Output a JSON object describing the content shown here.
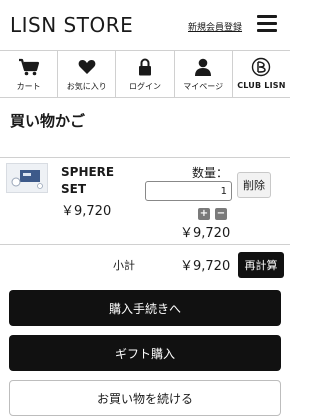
{
  "header": {
    "logo": "LISN STORE",
    "register_link": "新規会員登録"
  },
  "navbar": {
    "items": [
      {
        "label": "カート",
        "icon": "cart-icon"
      },
      {
        "label": "お気に入り",
        "icon": "heart-icon"
      },
      {
        "label": "ログイン",
        "icon": "lock-icon"
      },
      {
        "label": "マイページ",
        "icon": "user-icon"
      },
      {
        "label": "CLUB LISN",
        "icon": "club-lisn-icon"
      }
    ]
  },
  "page": {
    "title": "買い物かご"
  },
  "cart": {
    "items": [
      {
        "name_line1": "SPHERE",
        "name_line2": "SET",
        "price": "￥9,720",
        "quantity_label": "数量：",
        "quantity": "1",
        "delete_label": "削除",
        "line_total": "￥9,720"
      }
    ],
    "subtotal_label": "小計",
    "subtotal_value": "￥9,720",
    "recalc_label": "再計算"
  },
  "actions": {
    "checkout_label": "購入手続きへ",
    "gift_label": "ギフト購入",
    "continue_label": "お買い物を続ける"
  }
}
